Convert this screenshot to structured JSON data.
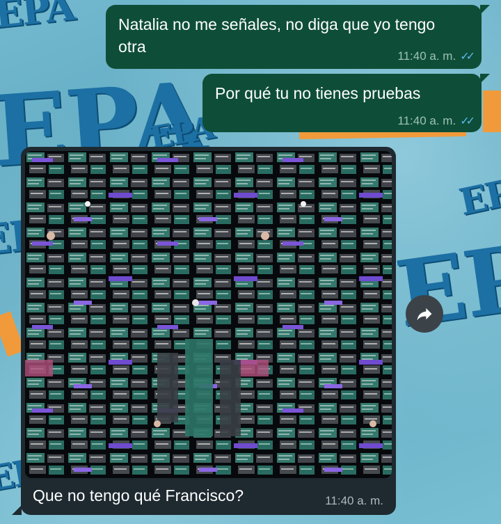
{
  "wallpaper": {
    "watermark_text": "EPA",
    "watermark_color": "#1c70a4",
    "accent_color": "#f19a3b"
  },
  "messages": [
    {
      "direction": "outgoing",
      "text": "Natalia no me señales, no diga que yo tengo otra",
      "time": "11:40 a. m.",
      "status": "read"
    },
    {
      "direction": "outgoing",
      "text": "Por qué tu no tienes pruebas",
      "time": "11:40 a. m.",
      "status": "read"
    },
    {
      "direction": "incoming",
      "type": "image",
      "image_description": "screenshot collage",
      "caption": "Que no tengo qué Francisco?",
      "time": "11:40 a. m."
    }
  ],
  "icons": {
    "read_receipt": "double-check-icon",
    "forward": "forward-arrow-icon"
  },
  "colors": {
    "outgoing_bubble": "#0e4e38",
    "incoming_bubble": "#1e2a30",
    "read_tick": "#5cb8f0"
  }
}
